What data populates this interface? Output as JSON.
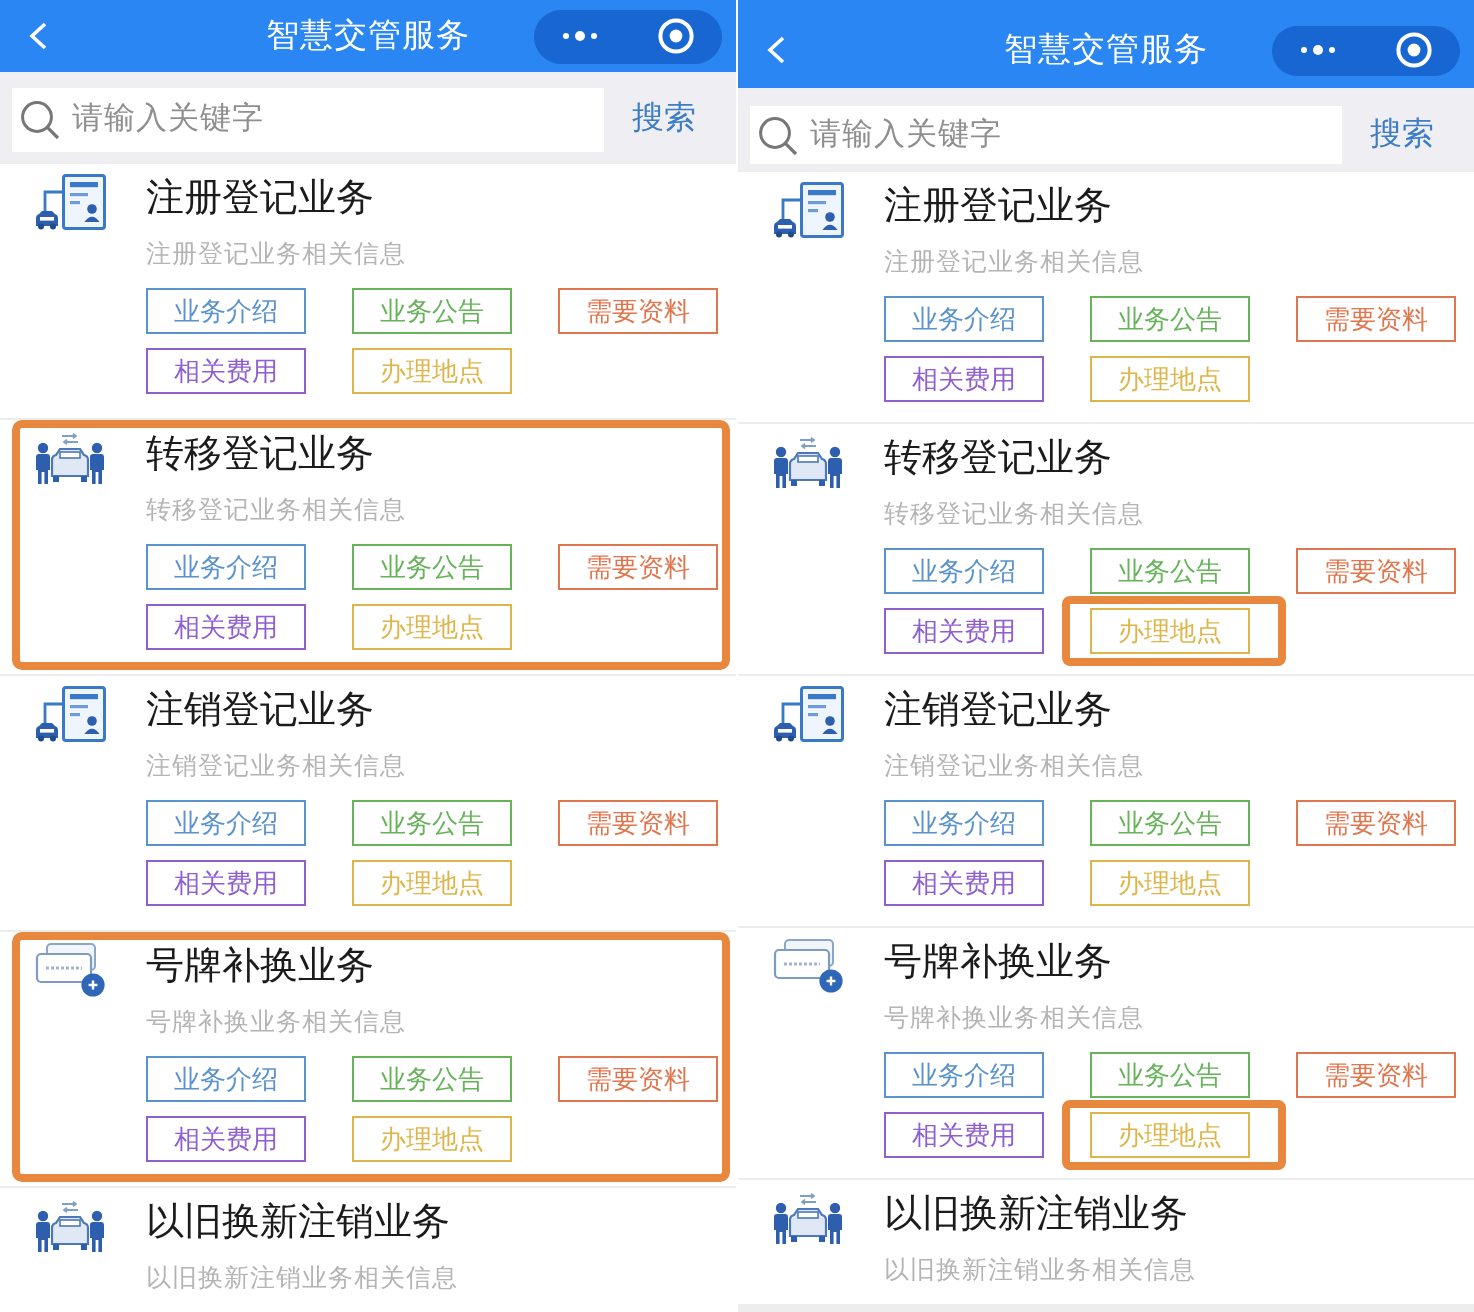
{
  "panels": [
    {
      "header": {
        "title": "智慧交管服务"
      },
      "search": {
        "placeholder": "请输入关键字",
        "button": "搜索"
      },
      "services": [
        {
          "kind": "document",
          "title": "注册登记业务",
          "subtitle": "注册登记业务相关信息",
          "highlighted": false,
          "tags": [
            {
              "label": "业务介绍",
              "color": "#5a93cc",
              "highlighted": false
            },
            {
              "label": "业务公告",
              "color": "#66b35a",
              "highlighted": false
            },
            {
              "label": "需要资料",
              "color": "#e0764e",
              "highlighted": false
            },
            {
              "label": "相关费用",
              "color": "#8f5fcf",
              "highlighted": false
            },
            {
              "label": "办理地点",
              "color": "#ddb548",
              "highlighted": false
            }
          ]
        },
        {
          "kind": "exchange",
          "title": "转移登记业务",
          "subtitle": "转移登记业务相关信息",
          "highlighted": true,
          "tags": [
            {
              "label": "业务介绍",
              "color": "#5a93cc",
              "highlighted": false
            },
            {
              "label": "业务公告",
              "color": "#66b35a",
              "highlighted": false
            },
            {
              "label": "需要资料",
              "color": "#e0764e",
              "highlighted": false
            },
            {
              "label": "相关费用",
              "color": "#8f5fcf",
              "highlighted": false
            },
            {
              "label": "办理地点",
              "color": "#ddb548",
              "highlighted": false
            }
          ]
        },
        {
          "kind": "document",
          "title": "注销登记业务",
          "subtitle": "注销登记业务相关信息",
          "highlighted": false,
          "tags": [
            {
              "label": "业务介绍",
              "color": "#5a93cc",
              "highlighted": false
            },
            {
              "label": "业务公告",
              "color": "#66b35a",
              "highlighted": false
            },
            {
              "label": "需要资料",
              "color": "#e0764e",
              "highlighted": false
            },
            {
              "label": "相关费用",
              "color": "#8f5fcf",
              "highlighted": false
            },
            {
              "label": "办理地点",
              "color": "#ddb548",
              "highlighted": false
            }
          ]
        },
        {
          "kind": "plate",
          "title": "号牌补换业务",
          "subtitle": "号牌补换业务相关信息",
          "highlighted": true,
          "tags": [
            {
              "label": "业务介绍",
              "color": "#5a93cc",
              "highlighted": false
            },
            {
              "label": "业务公告",
              "color": "#66b35a",
              "highlighted": false
            },
            {
              "label": "需要资料",
              "color": "#e0764e",
              "highlighted": false
            },
            {
              "label": "相关费用",
              "color": "#8f5fcf",
              "highlighted": false
            },
            {
              "label": "办理地点",
              "color": "#ddb548",
              "highlighted": false
            }
          ]
        },
        {
          "kind": "exchange",
          "title": "以旧换新注销业务",
          "subtitle": "以旧换新注销业务相关信息",
          "highlighted": false
        }
      ]
    },
    {
      "header": {
        "title": "智慧交管服务"
      },
      "search": {
        "placeholder": "请输入关键字",
        "button": "搜索"
      },
      "services": [
        {
          "kind": "document",
          "title": "注册登记业务",
          "subtitle": "注册登记业务相关信息",
          "highlighted": false,
          "tags": [
            {
              "label": "业务介绍",
              "color": "#5a93cc",
              "highlighted": false
            },
            {
              "label": "业务公告",
              "color": "#66b35a",
              "highlighted": false
            },
            {
              "label": "需要资料",
              "color": "#e0764e",
              "highlighted": false
            },
            {
              "label": "相关费用",
              "color": "#8f5fcf",
              "highlighted": false
            },
            {
              "label": "办理地点",
              "color": "#ddb548",
              "highlighted": false
            }
          ]
        },
        {
          "kind": "exchange",
          "title": "转移登记业务",
          "subtitle": "转移登记业务相关信息",
          "highlighted": false,
          "tags": [
            {
              "label": "业务介绍",
              "color": "#5a93cc",
              "highlighted": false
            },
            {
              "label": "业务公告",
              "color": "#66b35a",
              "highlighted": false
            },
            {
              "label": "需要资料",
              "color": "#e0764e",
              "highlighted": false
            },
            {
              "label": "相关费用",
              "color": "#8f5fcf",
              "highlighted": false
            },
            {
              "label": "办理地点",
              "color": "#ddb548",
              "highlighted": true
            }
          ]
        },
        {
          "kind": "document",
          "title": "注销登记业务",
          "subtitle": "注销登记业务相关信息",
          "highlighted": false,
          "tags": [
            {
              "label": "业务介绍",
              "color": "#5a93cc",
              "highlighted": false
            },
            {
              "label": "业务公告",
              "color": "#66b35a",
              "highlighted": false
            },
            {
              "label": "需要资料",
              "color": "#e0764e",
              "highlighted": false
            },
            {
              "label": "相关费用",
              "color": "#8f5fcf",
              "highlighted": false
            },
            {
              "label": "办理地点",
              "color": "#ddb548",
              "highlighted": false
            }
          ]
        },
        {
          "kind": "plate",
          "title": "号牌补换业务",
          "subtitle": "号牌补换业务相关信息",
          "highlighted": false,
          "tags": [
            {
              "label": "业务介绍",
              "color": "#5a93cc",
              "highlighted": false
            },
            {
              "label": "业务公告",
              "color": "#66b35a",
              "highlighted": false
            },
            {
              "label": "需要资料",
              "color": "#e0764e",
              "highlighted": false
            },
            {
              "label": "相关费用",
              "color": "#8f5fcf",
              "highlighted": false
            },
            {
              "label": "办理地点",
              "color": "#ddb548",
              "highlighted": true
            }
          ]
        },
        {
          "kind": "exchange",
          "title": "以旧换新注销业务",
          "subtitle": "以旧换新注销业务相关信息",
          "highlighted": false
        }
      ]
    }
  ]
}
